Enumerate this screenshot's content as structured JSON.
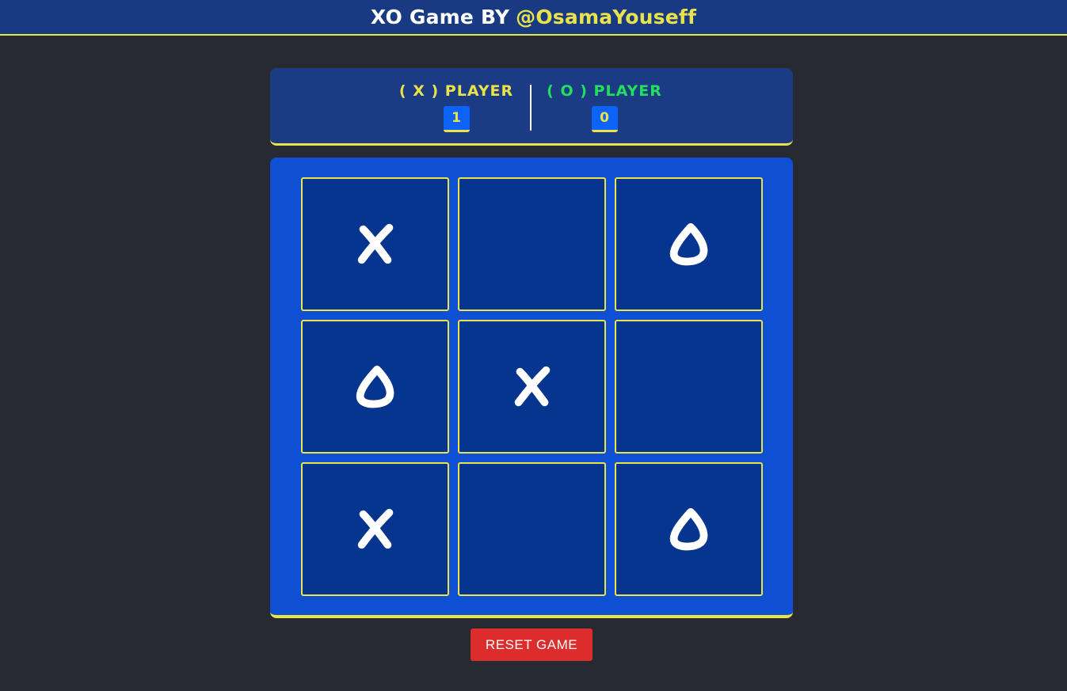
{
  "header": {
    "title_prefix": "XO Game BY",
    "handle": "@OsamaYouseff"
  },
  "scoreboard": {
    "x_player_label": "( X ) PLAYER",
    "x_score": "1",
    "o_player_label": "( O ) PLAYER",
    "o_score": "0"
  },
  "board": {
    "cells": [
      "X",
      "",
      "O",
      "O",
      "X",
      "",
      "X",
      "",
      "O"
    ]
  },
  "controls": {
    "reset_label": "RESET GAME"
  },
  "colors": {
    "background": "#272a31",
    "header": "#183a82",
    "accent_yellow": "#eae24a",
    "o_green": "#22e05a",
    "board": "#0f4fd3",
    "cell": "#06358f",
    "reset_red": "#dd2c2c"
  }
}
